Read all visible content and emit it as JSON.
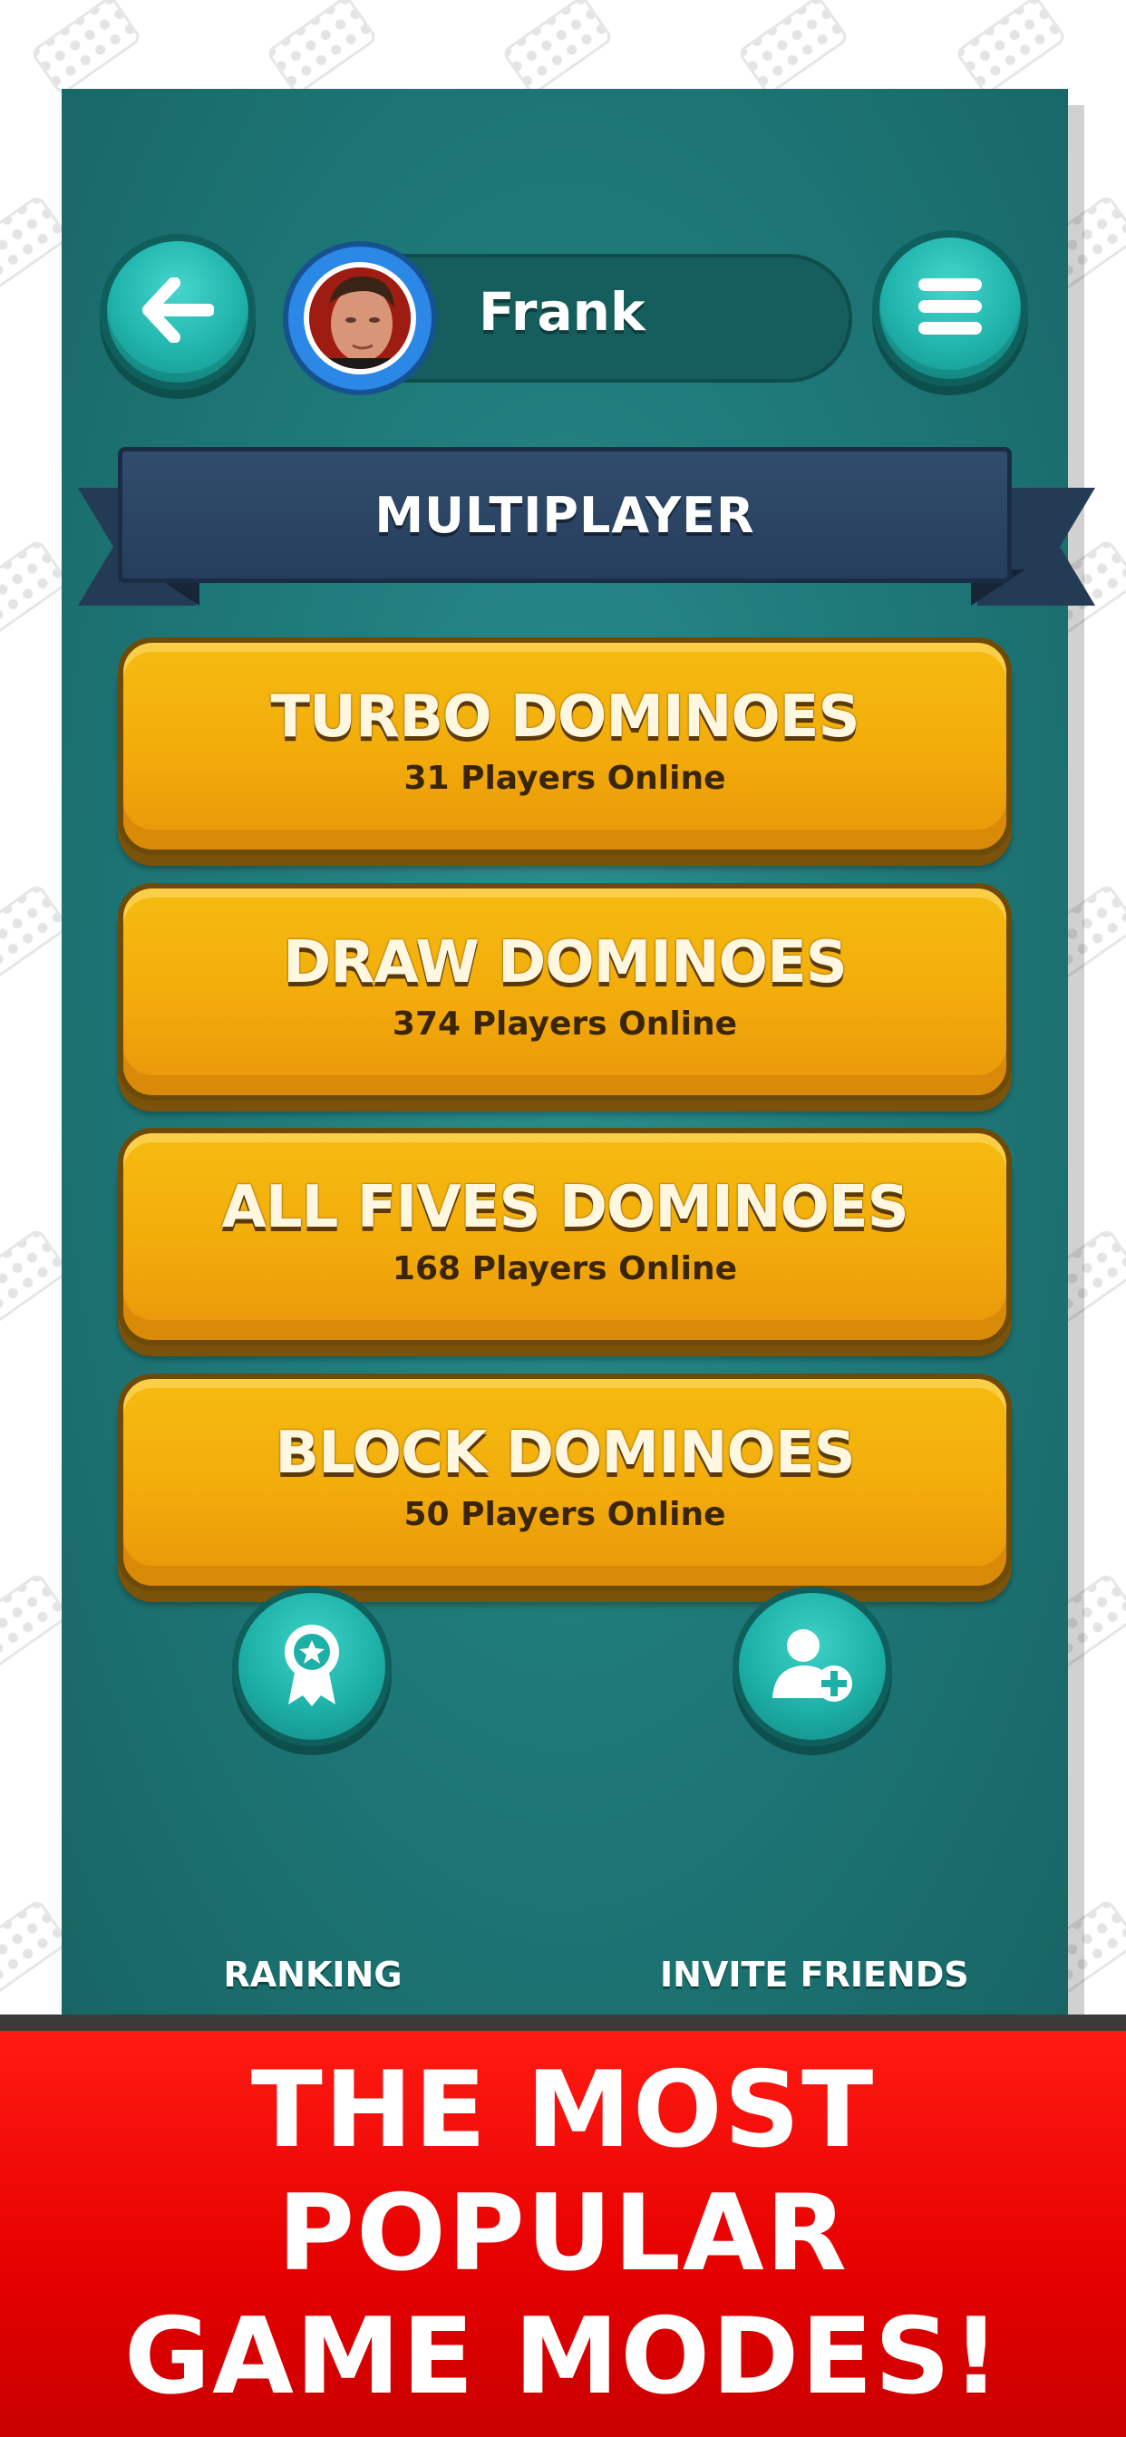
{
  "header": {
    "player_name": "Frank",
    "back_icon": "arrow-left-icon",
    "menu_icon": "hamburger-menu-icon"
  },
  "section": {
    "title": "MULTIPLAYER"
  },
  "modes": [
    {
      "title": "TURBO DOMINOES",
      "subtitle": "31 Players Online"
    },
    {
      "title": "DRAW DOMINOES",
      "subtitle": "374 Players Online"
    },
    {
      "title": "ALL FIVES DOMINOES",
      "subtitle": "168 Players Online"
    },
    {
      "title": "BLOCK DOMINOES",
      "subtitle": "50 Players Online"
    }
  ],
  "actions": {
    "ranking": {
      "label": "RANKING",
      "icon": "award-ribbon-icon"
    },
    "invite": {
      "label": "INVITE FRIENDS",
      "icon": "add-user-icon"
    }
  },
  "promo": {
    "line1": "THE MOST POPULAR",
    "line2": "GAME MODES!"
  },
  "colors": {
    "panel": "#1f7a7a",
    "button_gold": "#f3ad0b",
    "ribbon": "#2b4463",
    "promo_red": "#e50000"
  }
}
